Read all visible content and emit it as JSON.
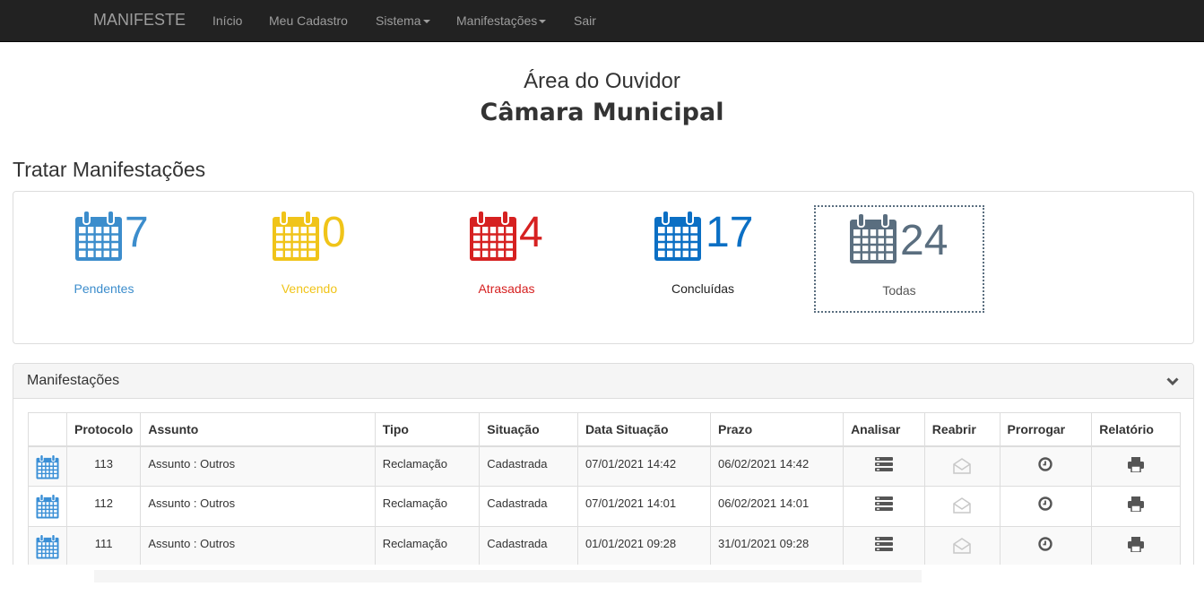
{
  "navbar": {
    "brand": "MANIFESTE",
    "items": [
      "Início",
      "Meu Cadastro",
      "Sistema",
      "Manifestações",
      "Sair"
    ]
  },
  "header": {
    "subtitle": "Área do Ouvidor",
    "title": "Câmara Municipal"
  },
  "section_title": "Tratar Manifestações",
  "stats": [
    {
      "value": "7",
      "label": "Pendentes",
      "color": "#3c8dcc"
    },
    {
      "value": "0",
      "label": "Vencendo",
      "color": "#f0c419"
    },
    {
      "value": "4",
      "label": "Atrasadas",
      "color": "#d62121"
    },
    {
      "value": "17",
      "label": "Concluídas",
      "color": "#0b6fc4"
    },
    {
      "value": "24",
      "label": "Todas",
      "color": "#5a6e7f"
    }
  ],
  "panel": {
    "title": "Manifestações",
    "columns": [
      "",
      "Protocolo",
      "Assunto",
      "Tipo",
      "Situação",
      "Data Situação",
      "Prazo",
      "Analisar",
      "Reabrir",
      "Prorrogar",
      "Relatório"
    ],
    "rows": [
      {
        "protocolo": "113",
        "assunto": "Assunto : Outros",
        "tipo": "Reclamação",
        "situacao": "Cadastrada",
        "data": "07/01/2021 14:42",
        "prazo": "06/02/2021 14:42"
      },
      {
        "protocolo": "112",
        "assunto": "Assunto : Outros",
        "tipo": "Reclamação",
        "situacao": "Cadastrada",
        "data": "07/01/2021 14:01",
        "prazo": "06/02/2021 14:01"
      },
      {
        "protocolo": "111",
        "assunto": "Assunto : Outros",
        "tipo": "Reclamação",
        "situacao": "Cadastrada",
        "data": "01/01/2021 09:28",
        "prazo": "31/01/2021 09:28"
      }
    ]
  },
  "icons": {
    "calendar": "calendar-icon",
    "analisar": "list-icon",
    "reabrir": "envelope-open-icon",
    "prorrogar": "clock-icon",
    "relatorio": "print-icon",
    "collapse": "chevron-down-icon"
  },
  "colors": {
    "navbar_bg": "#222222",
    "navbar_text": "#9d9d9d",
    "table_icon_blue": "#3a8fd6",
    "action_icon": "#555555"
  }
}
